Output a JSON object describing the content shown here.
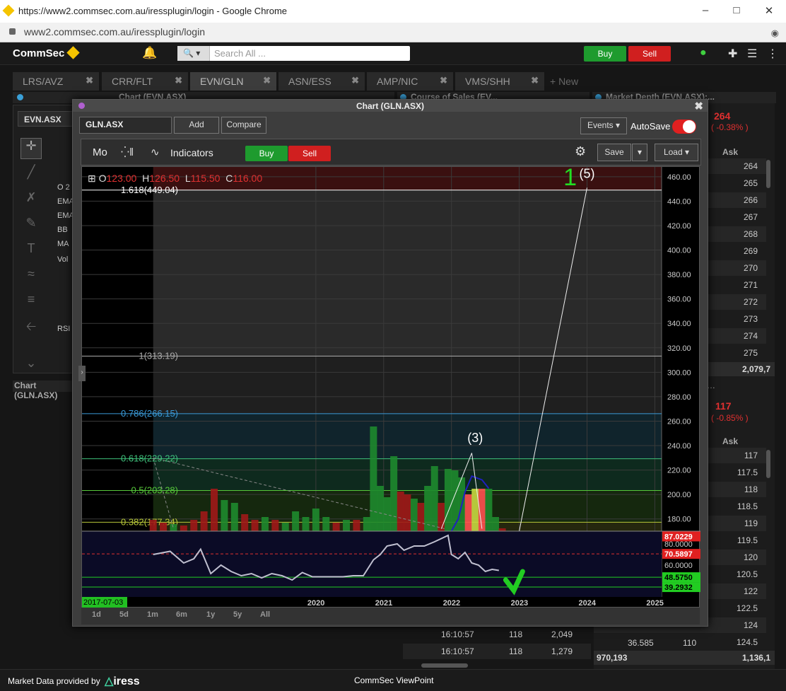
{
  "browser": {
    "window_title": "https://www2.commsec.com.au/iressplugin/login - Google Chrome",
    "url": "www2.commsec.com.au/iressplugin/login"
  },
  "topbar": {
    "logo": "CommSec",
    "search_placeholder": "Search All ...",
    "buy_label": "Buy",
    "sell_label": "Sell"
  },
  "tabs": [
    {
      "label": "LRS/AVZ",
      "active": false
    },
    {
      "label": "CRR/FLT",
      "active": false
    },
    {
      "label": "EVN/GLN",
      "active": true
    },
    {
      "label": "ASN/ESS",
      "active": false
    },
    {
      "label": "AMP/NIC",
      "active": false
    },
    {
      "label": "VMS/SHH",
      "active": false
    }
  ],
  "new_tab_label": "+ New",
  "panels": {
    "chart_evn": "Chart (EVN.ASX)",
    "course_of_sales": "Course of Sales (EV...",
    "market_depth": "Market Depth (EVN.ASX):...",
    "left_symbol": "EVN.ASX",
    "left_footer": "Chart (GLN.ASX)",
    "left_indicators": [
      "O 2",
      "EMA",
      "EMA",
      "BB",
      "MA",
      "Vol",
      "RSI"
    ]
  },
  "depth_top": {
    "price": "264",
    "change": "( -0.38% )",
    "col_header": "Ask",
    "asks": [
      "264",
      "265",
      "266",
      "267",
      "268",
      "269",
      "270",
      "271",
      "272",
      "273",
      "274",
      "275"
    ],
    "total": "2,079,7"
  },
  "depth_bottom": {
    "price": "117",
    "change": "( -0.85% )",
    "col_header": "Ask",
    "asks": [
      "117",
      "117.5",
      "118",
      "118.5",
      "119",
      "119.5",
      "120",
      "120.5",
      "122",
      "122.5",
      "124",
      "124.5"
    ],
    "row_last_left": "36.585",
    "row_last_mid": "110",
    "total_left": "970,193",
    "total_right": "1,136,1"
  },
  "course_rows": [
    {
      "time": "16:10:57",
      "price": "118",
      "volume": "2,049"
    },
    {
      "time": "16:10:57",
      "price": "118",
      "volume": "1,279"
    }
  ],
  "chart_window": {
    "title": "Chart (GLN.ASX)",
    "symbol": "GLN.ASX",
    "add_label": "Add",
    "compare_label": "Compare",
    "events_label": "Events",
    "autosave_label": "AutoSave",
    "period": "Mo",
    "indicators_label": "Indicators",
    "buy_label": "Buy",
    "sell_label": "Sell",
    "save_label": "Save",
    "load_label": "Load",
    "ohlc": {
      "o_label": "O",
      "o": "123.00",
      "h_label": "H",
      "h": "126.50",
      "l_label": "L",
      "l": "115.50",
      "c_label": "C",
      "c": "116.00"
    },
    "timeframes": [
      "1d",
      "5d",
      "1m",
      "6m",
      "1y",
      "5y",
      "All"
    ],
    "start_date": "2017-07-03"
  },
  "chart_data": {
    "type": "bar",
    "title": "",
    "y_ticks": [
      "460.00",
      "440.00",
      "420.00",
      "400.00",
      "380.00",
      "360.00",
      "340.00",
      "320.00",
      "300.00",
      "280.00",
      "260.00",
      "240.00",
      "220.00",
      "200.00",
      "180.00"
    ],
    "ylim": [
      170,
      468
    ],
    "x_ticks": [
      "2020",
      "2021",
      "2022",
      "2023",
      "2024",
      "2025"
    ],
    "fib_levels": [
      {
        "label": "1.618(449.04)",
        "value": 449.04,
        "color": "#ffffff"
      },
      {
        "label": "1(313.19)",
        "value": 313.19,
        "color": "#aaaaaa"
      },
      {
        "label": "0.786(266.15)",
        "value": 266.15,
        "color": "#3a9ad8"
      },
      {
        "label": "0.618(229.22)",
        "value": 229.22,
        "color": "#3ec07a"
      },
      {
        "label": "0.5(203.28)",
        "value": 203.28,
        "color": "#56c83a"
      },
      {
        "label": "0.382(177.34)",
        "value": 177.34,
        "color": "#b8c83a"
      }
    ],
    "wave_labels": [
      {
        "text": "(3)",
        "year": 2022.35,
        "price": 243
      },
      {
        "text": "(5)",
        "year": 2024.0,
        "price": 459
      },
      {
        "text": "1",
        "year": 2023.75,
        "price": 453
      }
    ],
    "projection_lines": [
      {
        "from": [
          2023.0,
          170
        ],
        "to": [
          2024.0,
          451
        ]
      },
      {
        "from": [
          2021.85,
          172
        ],
        "to": [
          2022.3,
          234
        ]
      },
      {
        "from": [
          2022.3,
          234
        ],
        "to": [
          2022.45,
          172
        ]
      }
    ],
    "volume_bars": [
      {
        "year": 2017.6,
        "vol": 8,
        "color": "#a01818"
      },
      {
        "year": 2017.75,
        "vol": 6,
        "color": "#a01818"
      },
      {
        "year": 2017.9,
        "vol": 5,
        "color": "#1e8a2e"
      },
      {
        "year": 2018.05,
        "vol": 4,
        "color": "#a01818"
      },
      {
        "year": 2018.2,
        "vol": 8,
        "color": "#a01818"
      },
      {
        "year": 2018.35,
        "vol": 14,
        "color": "#a01818"
      },
      {
        "year": 2018.5,
        "vol": 30,
        "color": "#a01818"
      },
      {
        "year": 2018.65,
        "vol": 22,
        "color": "#1e8a2e"
      },
      {
        "year": 2018.8,
        "vol": 20,
        "color": "#1e8a2e"
      },
      {
        "year": 2018.95,
        "vol": 12,
        "color": "#a01818"
      },
      {
        "year": 2019.1,
        "vol": 8,
        "color": "#a01818"
      },
      {
        "year": 2019.25,
        "vol": 10,
        "color": "#1e8a2e"
      },
      {
        "year": 2019.4,
        "vol": 8,
        "color": "#a01818"
      },
      {
        "year": 2019.55,
        "vol": 6,
        "color": "#1e8a2e"
      },
      {
        "year": 2019.7,
        "vol": 14,
        "color": "#1e8a2e"
      },
      {
        "year": 2019.85,
        "vol": 10,
        "color": "#1e8a2e"
      },
      {
        "year": 2020.0,
        "vol": 16,
        "color": "#1e8a2e"
      },
      {
        "year": 2020.15,
        "vol": 10,
        "color": "#1e8a2e"
      },
      {
        "year": 2020.3,
        "vol": 6,
        "color": "#a01818"
      },
      {
        "year": 2020.45,
        "vol": 8,
        "color": "#1e8a2e"
      },
      {
        "year": 2020.6,
        "vol": 8,
        "color": "#a01818"
      },
      {
        "year": 2020.75,
        "vol": 10,
        "color": "#1e8a2e"
      },
      {
        "year": 2020.85,
        "vol": 74,
        "color": "#1e8a2e"
      },
      {
        "year": 2020.95,
        "vol": 32,
        "color": "#1e8a2e"
      },
      {
        "year": 2021.05,
        "vol": 24,
        "color": "#1e8a2e"
      },
      {
        "year": 2021.15,
        "vol": 53,
        "color": "#1e8a2e"
      },
      {
        "year": 2021.25,
        "vol": 28,
        "color": "#a01818"
      },
      {
        "year": 2021.35,
        "vol": 26,
        "color": "#a01818"
      },
      {
        "year": 2021.45,
        "vol": 23,
        "color": "#1e8a2e"
      },
      {
        "year": 2021.55,
        "vol": 20,
        "color": "#a01818"
      },
      {
        "year": 2021.65,
        "vol": 32,
        "color": "#1e8a2e"
      },
      {
        "year": 2021.75,
        "vol": 46,
        "color": "#1e8a2e"
      },
      {
        "year": 2021.85,
        "vol": 20,
        "color": "#a01818"
      },
      {
        "year": 2021.95,
        "vol": 44,
        "color": "#1e8a2e"
      },
      {
        "year": 2022.05,
        "vol": 43,
        "color": "#1e8a2e"
      },
      {
        "year": 2022.15,
        "vol": 38,
        "color": "#1e8a2e"
      },
      {
        "year": 2022.25,
        "vol": 26,
        "color": "#ff5050"
      },
      {
        "year": 2022.35,
        "vol": 30,
        "color": "#c8d840"
      },
      {
        "year": 2022.45,
        "vol": 30,
        "color": "#ff5050"
      },
      {
        "year": 2022.55,
        "vol": 30,
        "color": "#1e8a2e"
      },
      {
        "year": 2022.65,
        "vol": 10,
        "color": "#1e8a2e"
      },
      {
        "year": 2022.75,
        "vol": 2,
        "color": "#a01818"
      }
    ],
    "ma_line": {
      "color": "#2020c0",
      "points": [
        [
          2022.0,
          170
        ],
        [
          2022.1,
          180
        ],
        [
          2022.2,
          202
        ],
        [
          2022.3,
          215
        ],
        [
          2022.45,
          212
        ],
        [
          2022.55,
          205
        ]
      ]
    },
    "rsi": {
      "ticks": [
        "80.0000",
        "60.0000"
      ],
      "labels": [
        {
          "text": "87.0229",
          "value": 87.0229,
          "color": "#e02020"
        },
        {
          "text": "70.5897",
          "value": 70.5897,
          "color": "#e02020"
        },
        {
          "text": "48.5750",
          "value": 48.575,
          "color": "#22cc22"
        },
        {
          "text": "39.2932",
          "value": 39.2932,
          "color": "#22cc22"
        }
      ],
      "points": [
        [
          2017.6,
          70
        ],
        [
          2017.85,
          73
        ],
        [
          2018.05,
          62
        ],
        [
          2018.2,
          66
        ],
        [
          2018.3,
          75
        ],
        [
          2018.45,
          52
        ],
        [
          2018.6,
          60
        ],
        [
          2018.75,
          54
        ],
        [
          2018.9,
          50
        ],
        [
          2019.05,
          52
        ],
        [
          2019.2,
          48
        ],
        [
          2019.35,
          52
        ],
        [
          2019.5,
          50
        ],
        [
          2019.65,
          46
        ],
        [
          2019.8,
          53
        ],
        [
          2019.95,
          49
        ],
        [
          2020.1,
          49
        ],
        [
          2020.25,
          49
        ],
        [
          2020.4,
          49
        ],
        [
          2020.55,
          50
        ],
        [
          2020.7,
          50
        ],
        [
          2020.85,
          65
        ],
        [
          2020.95,
          70
        ],
        [
          2021.05,
          78
        ],
        [
          2021.2,
          80
        ],
        [
          2021.3,
          74
        ],
        [
          2021.45,
          78
        ],
        [
          2021.6,
          78
        ],
        [
          2021.75,
          82
        ],
        [
          2021.85,
          85
        ],
        [
          2021.95,
          88
        ],
        [
          2022.0,
          70
        ],
        [
          2022.1,
          66
        ],
        [
          2022.2,
          72
        ],
        [
          2022.3,
          62
        ],
        [
          2022.4,
          60
        ],
        [
          2022.5,
          54
        ],
        [
          2022.6,
          56
        ],
        [
          2022.7,
          55
        ]
      ],
      "ylim": [
        30,
        92
      ]
    },
    "x_range": [
      2016.55,
      2025.1
    ]
  },
  "status": {
    "provided_by": "Market Data provided by",
    "iress": "iress",
    "app": "CommSec ViewPoint"
  },
  "colors": {
    "buy": "#1e9b2e",
    "sell": "#d01f1f",
    "accent": "#f5c400"
  }
}
